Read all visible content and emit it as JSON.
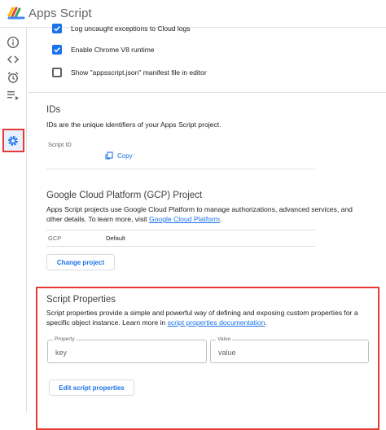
{
  "app": {
    "title": "Apps Script"
  },
  "settings": {
    "checkboxes": [
      {
        "label": "Log uncaught exceptions to Cloud logs",
        "checked": true
      },
      {
        "label": "Enable Chrome V8 runtime",
        "checked": true
      },
      {
        "label": "Show \"appsscript.json\" manifest file in editor",
        "checked": false
      }
    ]
  },
  "ids": {
    "title": "IDs",
    "description": "IDs are the unique identifiers of your Apps Script project.",
    "script_id_label": "Script ID",
    "copy_label": "Copy"
  },
  "gcp": {
    "title": "Google Cloud Platform (GCP) Project",
    "description_line1": "Apps Script projects use Google Cloud Platform to manage authorizations, advanced services, and",
    "description_line2": "other details. To learn more, visit ",
    "link": "Google Cloud Platform",
    "description_end": ".",
    "row_label": "GCP",
    "row_value": "Default",
    "button": "Change project"
  },
  "script_properties": {
    "title": "Script Properties",
    "description_line1": "Script properties provide a simple and powerful way of defining and exposing custom properties for a",
    "description_line2": "specific object instance. Learn more in ",
    "link": "script properties documentation",
    "description_end": ".",
    "property_label": "Property",
    "property_placeholder": "key",
    "value_label": "Value",
    "value_placeholder": "value",
    "button": "Edit script properties"
  },
  "colors": {
    "accent": "#1a73e8",
    "highlight": "#e53935"
  }
}
